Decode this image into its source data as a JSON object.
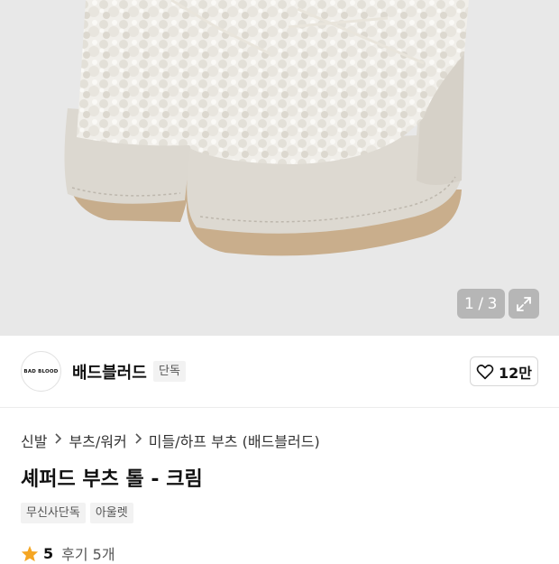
{
  "gallery": {
    "current": "1",
    "separator": "/",
    "total": "3",
    "expand_icon": "expand-arrows-icon"
  },
  "brand": {
    "logo_text": "BAD BLOOD",
    "name": "배드블러드",
    "badge": "단독",
    "like_count": "12만",
    "like_icon": "heart-outline-icon"
  },
  "breadcrumb": {
    "items": [
      "신발",
      "부츠/워커",
      "미들/하프 부츠 (배드블러드)"
    ],
    "separator_icon": "chevron-right-icon"
  },
  "product": {
    "title": "셰퍼드 부츠 톨 - 크림",
    "tags": [
      "무신사단독",
      "아울렛"
    ],
    "rating": "5",
    "rating_icon": "star-icon",
    "rating_color": "#f5a623",
    "reviews": "후기 5개"
  }
}
